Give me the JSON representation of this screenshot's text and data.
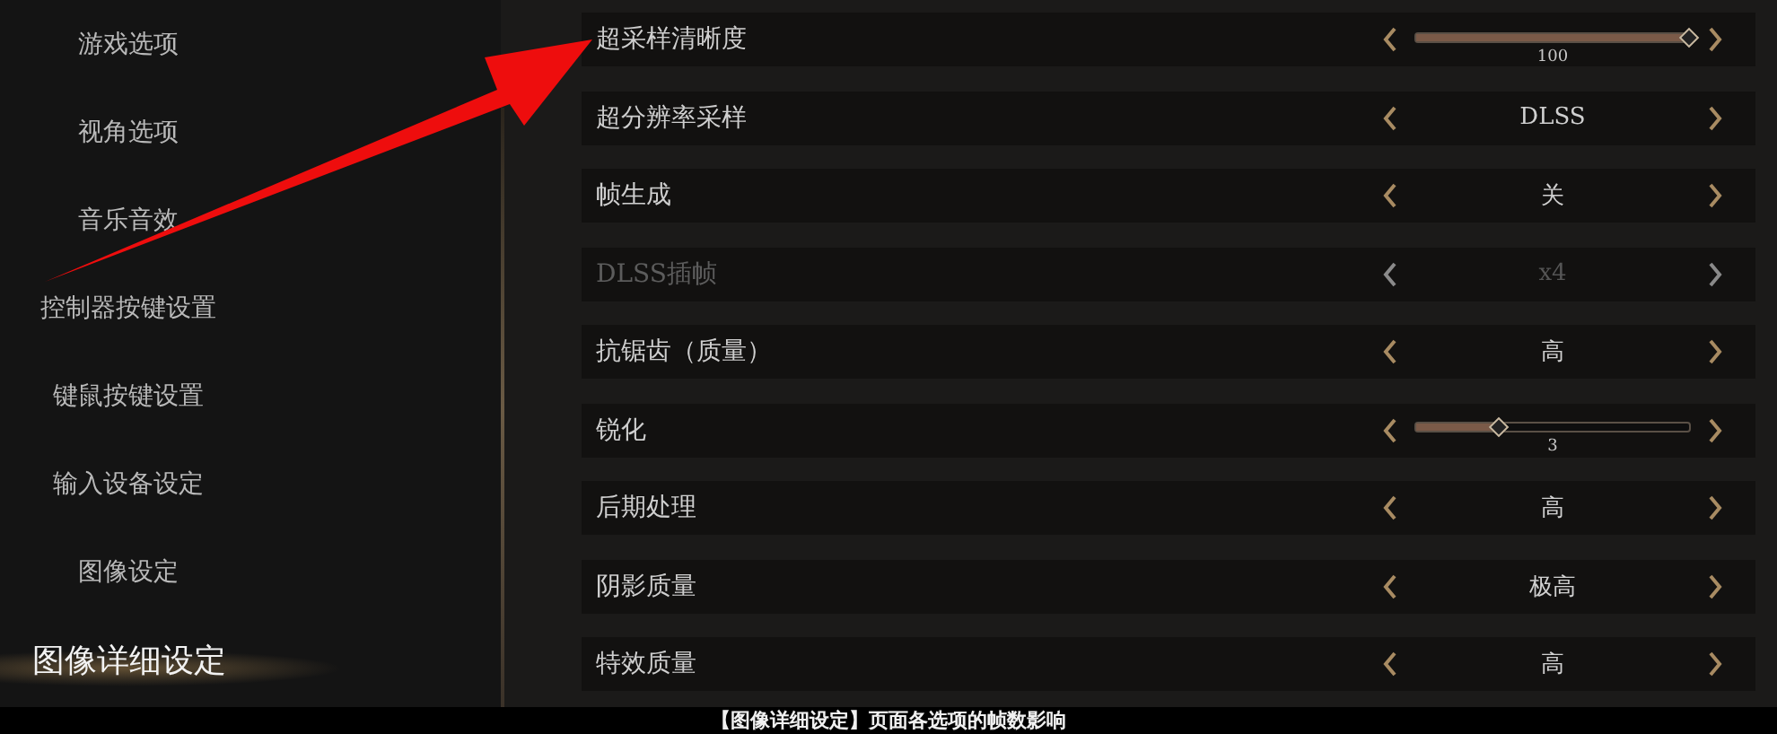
{
  "sidebar": {
    "items": [
      {
        "label": "游戏选项",
        "selected": false
      },
      {
        "label": "视角选项",
        "selected": false
      },
      {
        "label": "音乐音效",
        "selected": false
      },
      {
        "label": "控制器按键设置",
        "selected": false
      },
      {
        "label": "键鼠按键设置",
        "selected": false
      },
      {
        "label": "输入设备设定",
        "selected": false
      },
      {
        "label": "图像设定",
        "selected": false
      },
      {
        "label": "图像详细设定",
        "selected": true
      }
    ]
  },
  "settings": [
    {
      "kind": "slider",
      "label": "超采样清晰度",
      "level": 1,
      "value": "100",
      "disabled": false
    },
    {
      "kind": "choice",
      "label": "超分辨率采样",
      "value": "DLSS",
      "disabled": false
    },
    {
      "kind": "choice",
      "label": "帧生成",
      "value": "关",
      "disabled": false
    },
    {
      "kind": "choice",
      "label": "DLSS插帧",
      "value": "x4",
      "disabled": true
    },
    {
      "kind": "choice",
      "label": "抗锯齿（质量）",
      "value": "高",
      "disabled": false
    },
    {
      "kind": "slider",
      "label": "锐化",
      "level": 0.3,
      "value": "3",
      "disabled": false
    },
    {
      "kind": "choice",
      "label": "后期处理",
      "value": "高",
      "disabled": false
    },
    {
      "kind": "choice",
      "label": "阴影质量",
      "value": "极高",
      "disabled": false
    },
    {
      "kind": "choice",
      "label": "特效质量",
      "value": "高",
      "disabled": false
    }
  ],
  "caption": "【图像详细设定】页面各选项的帧数影响"
}
